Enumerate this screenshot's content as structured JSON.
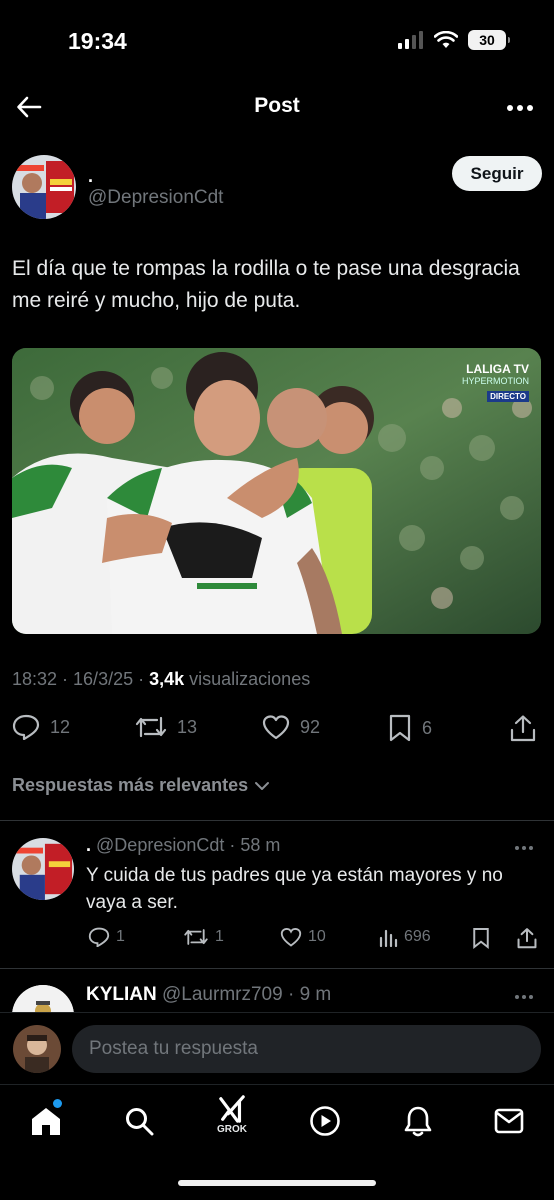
{
  "status": {
    "time": "19:34",
    "battery": "30"
  },
  "header": {
    "title": "Post"
  },
  "post": {
    "author_name": ".",
    "author_handle": "@DepresionCdt",
    "follow_label": "Seguir",
    "text": "El día que te rompas la rodilla o te pase una desgracia me reiré y mucho, hijo de puta.",
    "media_badge": {
      "line1": "LALIGA TV",
      "line2": "HYPERMOTION",
      "line3": "DIRECTO"
    },
    "meta_time": "18:32 · 16/3/25 · ",
    "meta_views": "3,4k",
    "meta_views_label": " visualizaciones",
    "counts": {
      "replies": "12",
      "reposts": "13",
      "likes": "92",
      "bookmarks": "6"
    }
  },
  "replies_sort_label": "Respuestas más relevantes",
  "replies": [
    {
      "name": ".",
      "handle": "@DepresionCdt",
      "time": "· 58 m",
      "text": "Y cuida de tus padres que ya están mayores y no vaya a ser.",
      "counts": {
        "replies": "1",
        "reposts": "1",
        "likes": "10",
        "views": "696"
      }
    },
    {
      "name": "KYLIAN",
      "handle": "@Laurmrz709",
      "time": "· 9 m"
    }
  ],
  "composer": {
    "placeholder": "Postea tu respuesta"
  },
  "tabbar": {
    "grok_label": "GROK"
  },
  "colors": {
    "accent": "#1d9bf0",
    "muted": "#71767b",
    "follow_bg": "#eff3f4"
  }
}
